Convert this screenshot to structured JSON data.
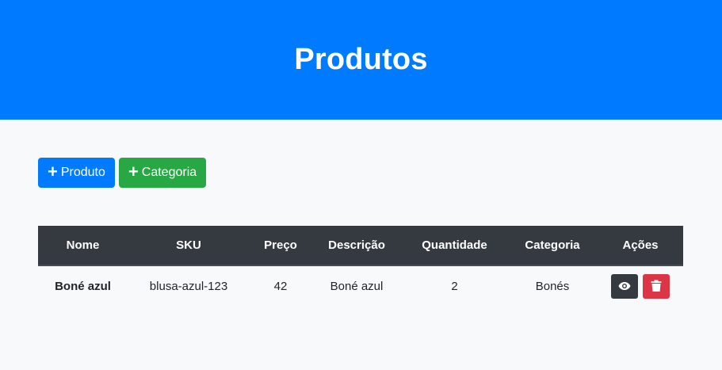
{
  "header": {
    "title": "Produtos"
  },
  "toolbar": {
    "add_product_label": "Produto",
    "add_category_label": "Categoria",
    "plus_icon": "plus-icon"
  },
  "table": {
    "columns": [
      "Nome",
      "SKU",
      "Preço",
      "Descrição",
      "Quantidade",
      "Categoria",
      "Ações"
    ],
    "rows": [
      {
        "nome": "Boné azul",
        "sku": "blusa-azul-123",
        "preco": "42",
        "descricao": "Boné azul",
        "quantidade": "2",
        "categoria": "Bonés",
        "actions": [
          "eye-icon",
          "trash-icon"
        ]
      }
    ]
  },
  "colors": {
    "primary": "#007bff",
    "success": "#28a745",
    "danger": "#dc3545",
    "dark": "#343a40",
    "background": "#f8f9fa"
  }
}
